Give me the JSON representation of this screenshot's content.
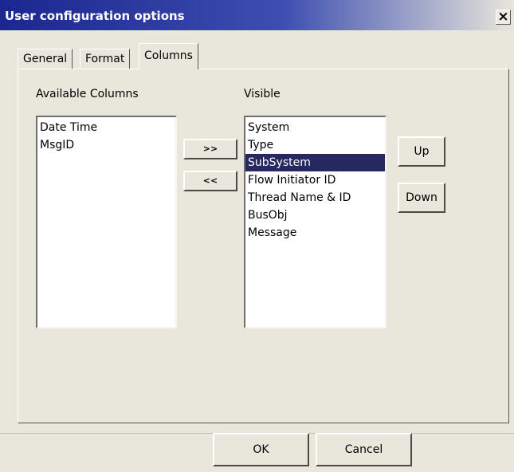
{
  "window": {
    "title": "User configuration options",
    "close_glyph": "×"
  },
  "tabs": [
    {
      "label": "General",
      "active": false
    },
    {
      "label": "Format",
      "active": false
    },
    {
      "label": "Columns",
      "active": true
    }
  ],
  "available": {
    "label": "Available Columns",
    "items": [
      "Date Time",
      "MsgID"
    ]
  },
  "visible": {
    "label": "Visible",
    "items": [
      "System",
      "Type",
      "SubSystem",
      "Flow  Initiator  ID",
      "Thread  Name & ID",
      "BusObj",
      "Message"
    ],
    "selected_item": "SubSystem"
  },
  "buttons": {
    "add": ">>",
    "remove": "<<",
    "up": "Up",
    "down": "Down",
    "ok": "OK",
    "cancel": "Cancel"
  },
  "colors": {
    "titlebar_start": "#1c2690",
    "selection": "#25295f",
    "face": "#e9e6dc"
  }
}
